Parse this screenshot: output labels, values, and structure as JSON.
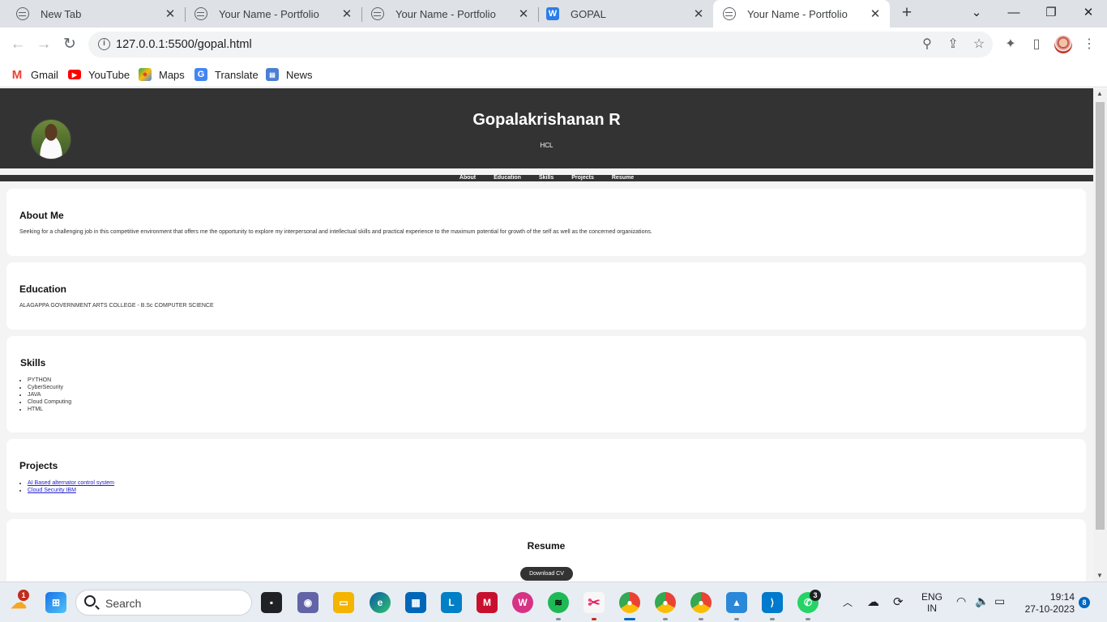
{
  "browser": {
    "tabs": [
      {
        "title": "New Tab",
        "icon": "chrome-globe-icon"
      },
      {
        "title": "Your Name - Portfolio",
        "icon": "globe-icon"
      },
      {
        "title": "Your Name - Portfolio",
        "icon": "globe-icon"
      },
      {
        "title": "GOPAL",
        "icon": "w-app-icon",
        "icon_letter": "W"
      },
      {
        "title": "Your Name - Portfolio",
        "icon": "globe-icon",
        "active": true
      }
    ],
    "url": "127.0.0.1:5500/gopal.html",
    "bookmarks": [
      {
        "label": "Gmail",
        "icon": "gmail-icon"
      },
      {
        "label": "YouTube",
        "icon": "youtube-icon"
      },
      {
        "label": "Maps",
        "icon": "maps-icon"
      },
      {
        "label": "Translate",
        "icon": "translate-icon"
      },
      {
        "label": "News",
        "icon": "news-icon"
      }
    ]
  },
  "site": {
    "name": "Gopalakrishanan R",
    "company": "HCL",
    "nav": [
      "About",
      "Education",
      "Skills",
      "Projects",
      "Resume"
    ],
    "about": {
      "heading": "About Me",
      "text": "Seeking for a challenging job in this competitive environment that offers me the opportunity to explore my interpersonal and intellectual skills and practical experience to the maximum potential for growth of the self as well as the concerned organizations."
    },
    "education": {
      "heading": "Education",
      "text": "ALAGAPPA GOVERNMENT ARTS COLLEGE - B.Sc COMPUTER SCIENCE"
    },
    "skills": {
      "heading": "Skills",
      "items": [
        "PYTHON",
        "CyberSecurity",
        "JAVA",
        "Cloud Computing",
        "HTML"
      ]
    },
    "projects": {
      "heading": "Projects",
      "items": [
        "AI Based alternator control system",
        "Cloud Security IBM"
      ]
    },
    "resume": {
      "heading": "Resume",
      "button": "Download CV"
    }
  },
  "taskbar": {
    "search_placeholder": "Search",
    "weather_badge": "1",
    "whatsapp_badge": "3",
    "notification_badge": "8",
    "lang_top": "ENG",
    "lang_bottom": "IN",
    "time": "19:14",
    "date": "27-10-2023"
  }
}
